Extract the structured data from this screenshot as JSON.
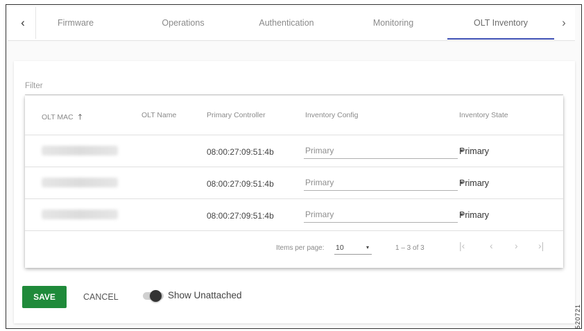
{
  "tabs": {
    "prev_icon": "chevron-left-icon",
    "prev_glyph": "‹",
    "next_icon": "chevron-right-icon",
    "next_glyph": "›",
    "items": [
      "Firmware",
      "Operations",
      "Authentication",
      "Monitoring",
      "OLT Inventory"
    ],
    "active": "OLT Inventory",
    "accent": "#3f51b5"
  },
  "filter": {
    "label": "Filter"
  },
  "table": {
    "columns": {
      "mac": "OLT MAC",
      "mac_sort_icon": "arrow-up-icon",
      "mac_sort_glyph": "🡑",
      "name": "OLT Name",
      "controller": "Primary Controller",
      "config": "Inventory Config",
      "state": "Inventory State"
    },
    "rows": [
      {
        "mac": "",
        "name": "",
        "controller": "08:00:27:09:51:4b",
        "config": "Primary",
        "state": "Primary"
      },
      {
        "mac": "",
        "name": "",
        "controller": "08:00:27:09:51:4b",
        "config": "Primary",
        "state": "Primary"
      },
      {
        "mac": "",
        "name": "",
        "controller": "08:00:27:09:51:4b",
        "config": "Primary",
        "state": "Primary"
      }
    ],
    "dropdown_glyph": "▾"
  },
  "pagination": {
    "items_per_page_label": "Items per page:",
    "items_per_page": "10",
    "range": "1 – 3 of 3",
    "first_glyph": "|‹",
    "prev_glyph": "‹",
    "next_glyph": "›",
    "last_glyph": "›|"
  },
  "actions": {
    "save": "SAVE",
    "cancel": "CANCEL",
    "toggle_label": "Show Unattached",
    "toggle_on": false,
    "save_color": "#1f8a3a"
  },
  "figure_id": "520721"
}
